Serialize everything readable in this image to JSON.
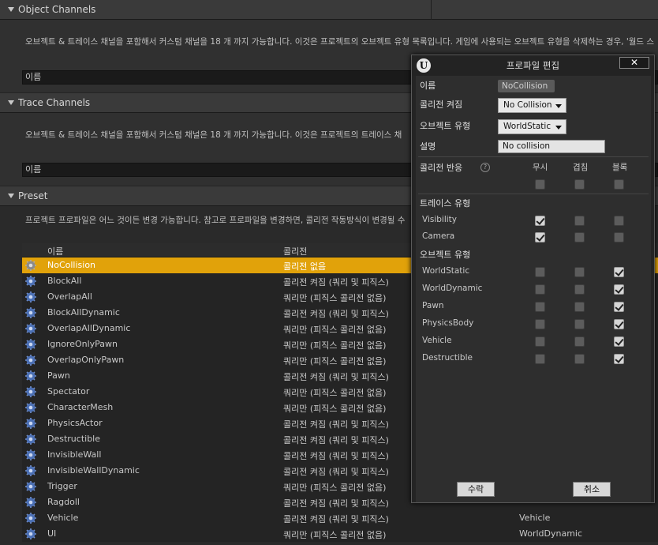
{
  "object_channels": {
    "title": "Object Channels",
    "description": "오브젝트 & 트레이스 채널을 포함해서 커스텀 채널을 18 개 까지 가능합니다. 이것은 프로젝트의 오브젝트 유형 목록입니다. 게임에 사용되는 오브젝트 유형을 삭제하는 경우, '월드 스",
    "name_header": "이름"
  },
  "trace_channels": {
    "title": "Trace Channels",
    "description": "오브젝트 & 트레이스 채널을 포함해서 커스텀 채널은 18 개 까지 가능합니다. 이것은 프로젝트의 트레이스 채",
    "name_header": "이름"
  },
  "preset": {
    "title": "Preset",
    "description": "프로젝트 프로파일은 어느 것이든 변경 가능합니다. 참고로 프로파일을 변경하면, 콜리전 작동방식이 변경될 수",
    "columns": {
      "name": "이름",
      "collision": "콜리전"
    },
    "rows": [
      {
        "name": "NoCollision",
        "collision": "콜리전 없음",
        "object": "",
        "selected": true
      },
      {
        "name": "BlockAll",
        "collision": "콜리전 켜짐 (쿼리 및 피직스)",
        "object": ""
      },
      {
        "name": "OverlapAll",
        "collision": "쿼리만 (피직스 콜리전 없음)",
        "object": ""
      },
      {
        "name": "BlockAllDynamic",
        "collision": "콜리전 켜짐 (쿼리 및 피직스)",
        "object": ""
      },
      {
        "name": "OverlapAllDynamic",
        "collision": "쿼리만 (피직스 콜리전 없음)",
        "object": ""
      },
      {
        "name": "IgnoreOnlyPawn",
        "collision": "쿼리만 (피직스 콜리전 없음)",
        "object": ""
      },
      {
        "name": "OverlapOnlyPawn",
        "collision": "쿼리만 (피직스 콜리전 없음)",
        "object": ""
      },
      {
        "name": "Pawn",
        "collision": "콜리전 켜짐 (쿼리 및 피직스)",
        "object": ""
      },
      {
        "name": "Spectator",
        "collision": "쿼리만 (피직스 콜리전 없음)",
        "object": ""
      },
      {
        "name": "CharacterMesh",
        "collision": "쿼리만 (피직스 콜리전 없음)",
        "object": ""
      },
      {
        "name": "PhysicsActor",
        "collision": "콜리전 켜짐 (쿼리 및 피직스)",
        "object": ""
      },
      {
        "name": "Destructible",
        "collision": "콜리전 켜짐 (쿼리 및 피직스)",
        "object": ""
      },
      {
        "name": "InvisibleWall",
        "collision": "콜리전 켜짐 (쿼리 및 피직스)",
        "object": ""
      },
      {
        "name": "InvisibleWallDynamic",
        "collision": "콜리전 켜짐 (쿼리 및 피직스)",
        "object": ""
      },
      {
        "name": "Trigger",
        "collision": "쿼리만 (피직스 콜리전 없음)",
        "object": ""
      },
      {
        "name": "Ragdoll",
        "collision": "콜리전 켜짐 (쿼리 및 피직스)",
        "object": ""
      },
      {
        "name": "Vehicle",
        "collision": "콜리전 켜짐 (쿼리 및 피직스)",
        "object": "Vehicle"
      },
      {
        "name": "UI",
        "collision": "쿼리만 (피직스 콜리전 없음)",
        "object": "WorldDynamic"
      }
    ]
  },
  "dialog": {
    "title": "프로파일 편집",
    "logo": "U",
    "close_label": "✕",
    "name_label": "이름",
    "name_value": "NoCollision",
    "collision_enabled_label": "콜리전 켜짐",
    "collision_enabled_value": "No Collision",
    "object_type_label": "오브젝트 유형",
    "object_type_value": "WorldStatic",
    "description_label": "설명",
    "description_value": "No collision",
    "collision_response_label": "콜리전 반응",
    "help_glyph": "?",
    "response_columns": [
      "무시",
      "겹침",
      "블록"
    ],
    "trace_type_label": "트레이스 유형",
    "trace_types": [
      {
        "name": "Visibility",
        "state": 0
      },
      {
        "name": "Camera",
        "state": 0
      }
    ],
    "object_type_section_label": "오브젝트 유형",
    "object_types": [
      {
        "name": "WorldStatic",
        "state": 2
      },
      {
        "name": "WorldDynamic",
        "state": 2
      },
      {
        "name": "Pawn",
        "state": 2
      },
      {
        "name": "PhysicsBody",
        "state": 2
      },
      {
        "name": "Vehicle",
        "state": 2
      },
      {
        "name": "Destructible",
        "state": 2
      }
    ],
    "accept_label": "수락",
    "cancel_label": "취소"
  }
}
